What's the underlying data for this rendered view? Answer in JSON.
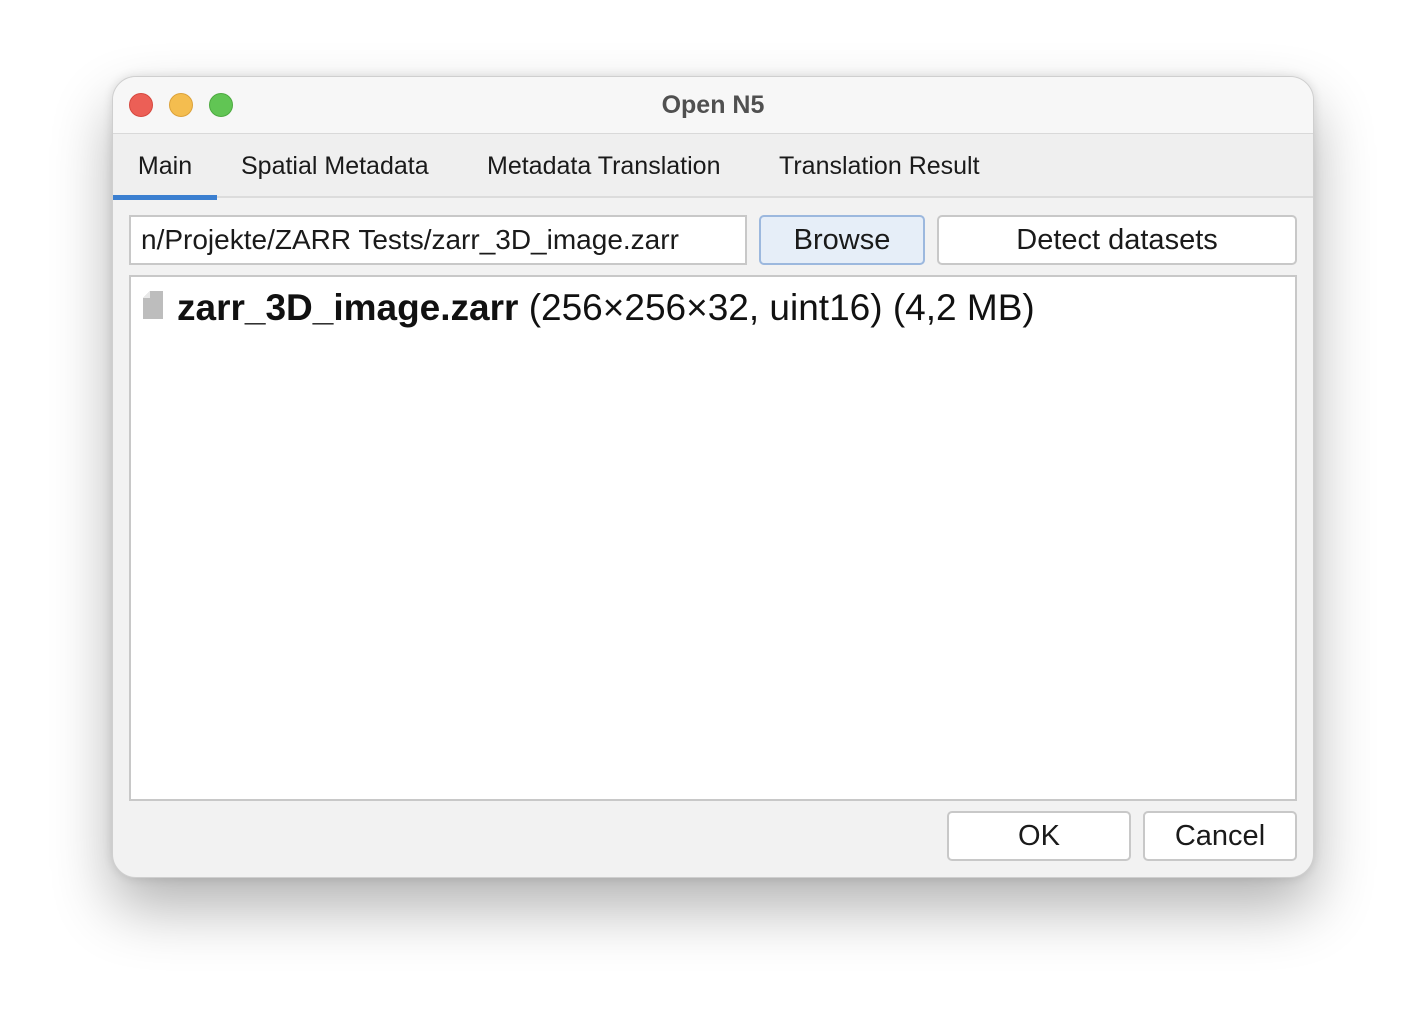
{
  "window": {
    "title": "Open N5"
  },
  "tabs": [
    {
      "label": "Main",
      "active": true
    },
    {
      "label": "Spatial Metadata",
      "active": false
    },
    {
      "label": "Metadata Translation",
      "active": false
    },
    {
      "label": "Translation Result",
      "active": false
    }
  ],
  "main": {
    "path_value": "n/Projekte/ZARR Tests/zarr_3D_image.zarr",
    "browse_label": "Browse",
    "detect_label": "Detect datasets",
    "datasets": [
      {
        "icon": "file-icon",
        "name": "zarr_3D_image.zarr",
        "details": " (256×256×32, uint16) (4,2 MB)"
      }
    ]
  },
  "footer": {
    "ok_label": "OK",
    "cancel_label": "Cancel"
  },
  "colors": {
    "accent": "#3b7fd0",
    "close": "#ec5f56",
    "minimize": "#f4bd4f",
    "maximize": "#61c554"
  }
}
